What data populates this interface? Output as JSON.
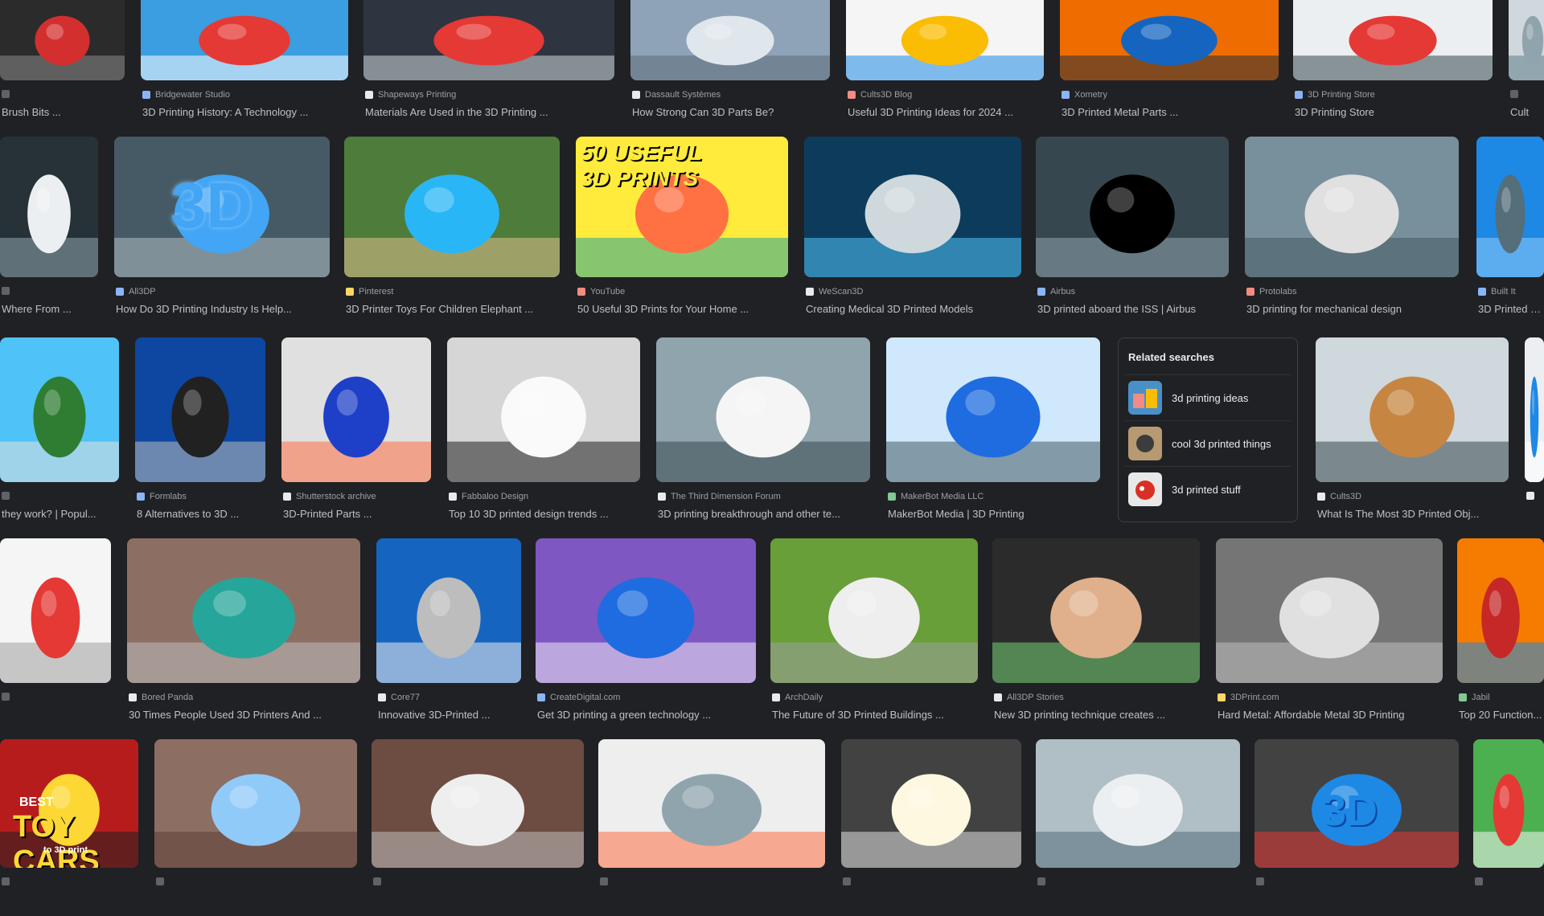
{
  "colors": {
    "background": "#202124",
    "text_primary": "#e8eaed",
    "text_secondary": "#9aa0a6",
    "accent_blue": "#1a73e8"
  },
  "rows": [
    {
      "items": [
        {
          "source": "",
          "title": "Brush Bits ...",
          "fav": "#5f6368",
          "theme": "red-print"
        },
        {
          "source": "Bridgewater Studio",
          "title": "3D Printing History: A Technology ...",
          "fav": "#8ab4f8",
          "theme": "red-lattice"
        },
        {
          "source": "Shapeways Printing",
          "title": "Materials Are Used in the 3D Printing ...",
          "fav": "#e8eaed",
          "theme": "red-figure"
        },
        {
          "source": "Dassault Systèmes",
          "title": "How Strong Can 3D Parts Be?",
          "fav": "#e8eaed",
          "theme": "grey-engine"
        },
        {
          "source": "Cults3D Blog",
          "title": "Useful 3D Printing Ideas for 2024 ...",
          "fav": "#f28b82",
          "theme": "toys"
        },
        {
          "source": "Xometry",
          "title": "3D Printed Metal Parts ...",
          "fav": "#8ab4f8",
          "theme": "blue-lattice"
        },
        {
          "source": "3D Printing Store",
          "title": "3D Printing Store",
          "fav": "#8ab4f8",
          "theme": "red-boat"
        },
        {
          "source": "",
          "title": "Cult",
          "fav": "#5f6368",
          "theme": "grey"
        }
      ]
    },
    {
      "items": [
        {
          "source": "",
          "title": "Where From ...",
          "fav": "#5f6368",
          "theme": "white-bowl"
        },
        {
          "source": "All3DP",
          "title": "How Do 3D Printing Industry Is Help...",
          "fav": "#8ab4f8",
          "theme": "blue-3d"
        },
        {
          "source": "Pinterest",
          "title": "3D Printer Toys For Children Elephant ...",
          "fav": "#fdd663",
          "theme": "dinosaurs"
        },
        {
          "source": "YouTube",
          "title": "50 Useful 3D Prints for Your Home ...",
          "fav": "#f28b82",
          "theme": "youtube-thumb"
        },
        {
          "source": "WeScan3D",
          "title": "Creating Medical 3D Printed Models",
          "fav": "#e8eaed",
          "theme": "nozzle"
        },
        {
          "source": "Airbus",
          "title": "3D printed aboard the ISS | Airbus",
          "fav": "#8ab4f8",
          "theme": "astronaut"
        },
        {
          "source": "Protolabs",
          "title": "3D printing for mechanical design",
          "fav": "#f28b82",
          "theme": "grey-bracket"
        },
        {
          "source": "Built It",
          "title": "3D Printed H...",
          "fav": "#8ab4f8",
          "theme": "blue-steel"
        }
      ]
    },
    {
      "items": [
        {
          "source": "",
          "title": "they work? | Popul...",
          "fav": "#5f6368",
          "theme": "printer-blue"
        },
        {
          "source": "Formlabs",
          "title": "8 Alternatives to 3D ...",
          "fav": "#8ab4f8",
          "theme": "extruder"
        },
        {
          "source": "Shutterstock archive",
          "title": "3D-Printed Parts ...",
          "fav": "#e8eaed",
          "theme": "blue-chain"
        },
        {
          "source": "Fabbaloo Design",
          "title": "Top 10 3D printed design trends ...",
          "fav": "#e8eaed",
          "theme": "white-shoe"
        },
        {
          "source": "The Third Dimension Forum",
          "title": "3D printing breakthrough and other te...",
          "fav": "#e8eaed",
          "theme": "hands"
        },
        {
          "source": "MakerBot Media LLC",
          "title": "MakerBot Media | 3D Printing",
          "fav": "#81c995",
          "theme": "blue-vase"
        }
      ],
      "trailing": [
        {
          "source": "Cults3D",
          "title": "What Is The Most 3D Printed Obj...",
          "fav": "#e8eaed",
          "theme": "elephant"
        },
        {
          "source": "",
          "title": "",
          "fav": "#e8eaed",
          "theme": "blue-white"
        }
      ]
    },
    {
      "items": [
        {
          "source": "",
          "title": "",
          "fav": "#5f6368",
          "theme": "white-printer"
        },
        {
          "source": "Bored Panda",
          "title": "30 Times People Used 3D Printers And ...",
          "fav": "#e8eaed",
          "theme": "teal-tower"
        },
        {
          "source": "Core77",
          "title": "Innovative 3D-Printed ...",
          "fav": "#e8eaed",
          "theme": "grey-castle"
        },
        {
          "source": "CreateDigital.com",
          "title": "Get 3D printing a green technology ...",
          "fav": "#8ab4f8",
          "theme": "purple-vase"
        },
        {
          "source": "ArchDaily",
          "title": "The Future of 3D Printed Buildings ...",
          "fav": "#e8eaed",
          "theme": "house"
        },
        {
          "source": "All3DP Stories",
          "title": "New 3D printing technique creates ...",
          "fav": "#e8eaed",
          "theme": "owls"
        },
        {
          "source": "3DPrint.com",
          "title": "Hard Metal: Affordable Metal 3D Printing",
          "fav": "#fdd663",
          "theme": "grey-lattice"
        },
        {
          "source": "Jabil",
          "title": "Top 20 Function...",
          "fav": "#81c995",
          "theme": "red-parts"
        }
      ]
    },
    {
      "items": [
        {
          "source": "",
          "title": "",
          "fav": "#5f6368",
          "theme": "toy-cars"
        },
        {
          "source": "",
          "title": "",
          "fav": "#5f6368",
          "theme": "blue-elephant"
        },
        {
          "source": "",
          "title": "",
          "fav": "#5f6368",
          "theme": "white-figures"
        },
        {
          "source": "",
          "title": "",
          "fav": "#5f6368",
          "theme": "house-print"
        },
        {
          "source": "",
          "title": "",
          "fav": "#5f6368",
          "theme": "phone-stand"
        },
        {
          "source": "",
          "title": "",
          "fav": "#5f6368",
          "theme": "factory"
        },
        {
          "source": "",
          "title": "",
          "fav": "#5f6368",
          "theme": "printer-3d"
        },
        {
          "source": "",
          "title": "",
          "fav": "#5f6368",
          "theme": "green-red"
        }
      ]
    }
  ],
  "overlay_text": {
    "youtube_thumb_line1": "50 USEFUL",
    "youtube_thumb_line2": "3D PRINTS",
    "toy_cars_top": "BEST",
    "toy_cars": "TOY CARS",
    "toy_cars_sub": "to 3D print",
    "printer_3d": "3D",
    "blue_3d": "3D"
  },
  "related_searches": {
    "heading": "Related searches",
    "items": [
      {
        "label": "3d printing ideas",
        "icon": "3d-printing-ideas-thumb"
      },
      {
        "label": "cool 3d printed things",
        "icon": "cool-printed-things-thumb"
      },
      {
        "label": "3d printed stuff",
        "icon": "printed-stuff-thumb"
      }
    ]
  }
}
